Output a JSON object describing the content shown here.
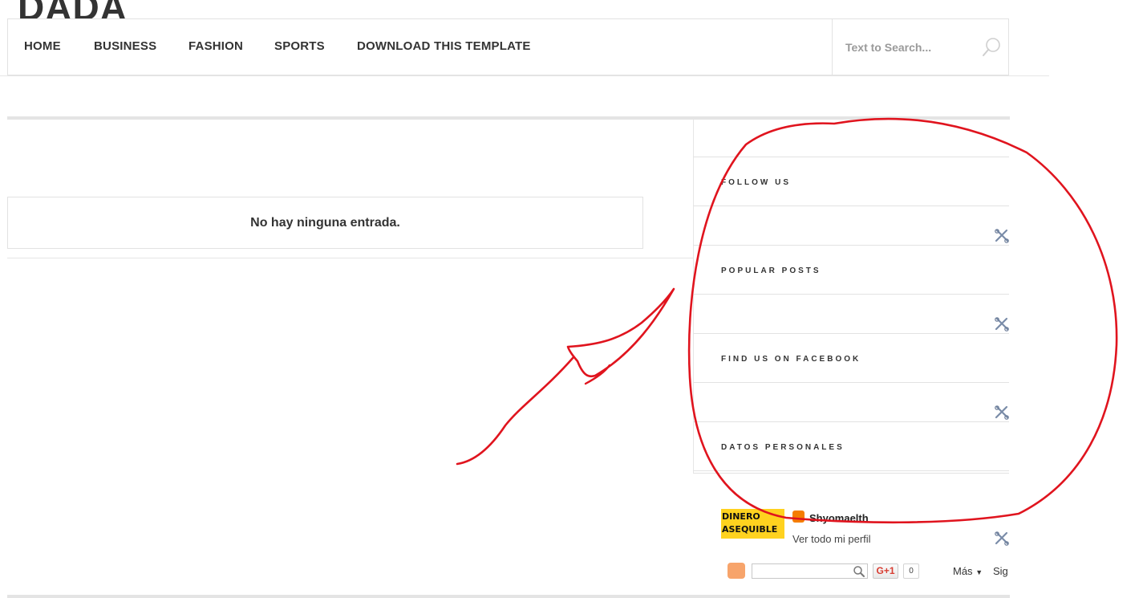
{
  "logo": {
    "text": "DADA"
  },
  "nav": {
    "items": [
      "HOME",
      "BUSINESS",
      "FASHION",
      "SPORTS",
      "DOWNLOAD THIS TEMPLATE"
    ],
    "search_placeholder": "Text to Search..."
  },
  "main": {
    "empty_message": "No hay ninguna entrada."
  },
  "sidebar": {
    "widgets": [
      {
        "title": "FOLLOW US"
      },
      {
        "title": "POPULAR POSTS"
      },
      {
        "title": "FIND US ON FACEBOOK"
      },
      {
        "title": "DATOS PERSONALES"
      }
    ],
    "profile": {
      "avatar_line1": "DINERO",
      "avatar_line2": "ASEQUIBLE",
      "name": "Shyomaelth",
      "link": "Ver todo mi perfil"
    }
  },
  "blogger_bar": {
    "gplus_label": "G+1",
    "gplus_count": "0",
    "more_label": "Más",
    "signin_label": "Sig"
  },
  "colors": {
    "annotation": "#e0141e",
    "accent_text": "#333333"
  }
}
